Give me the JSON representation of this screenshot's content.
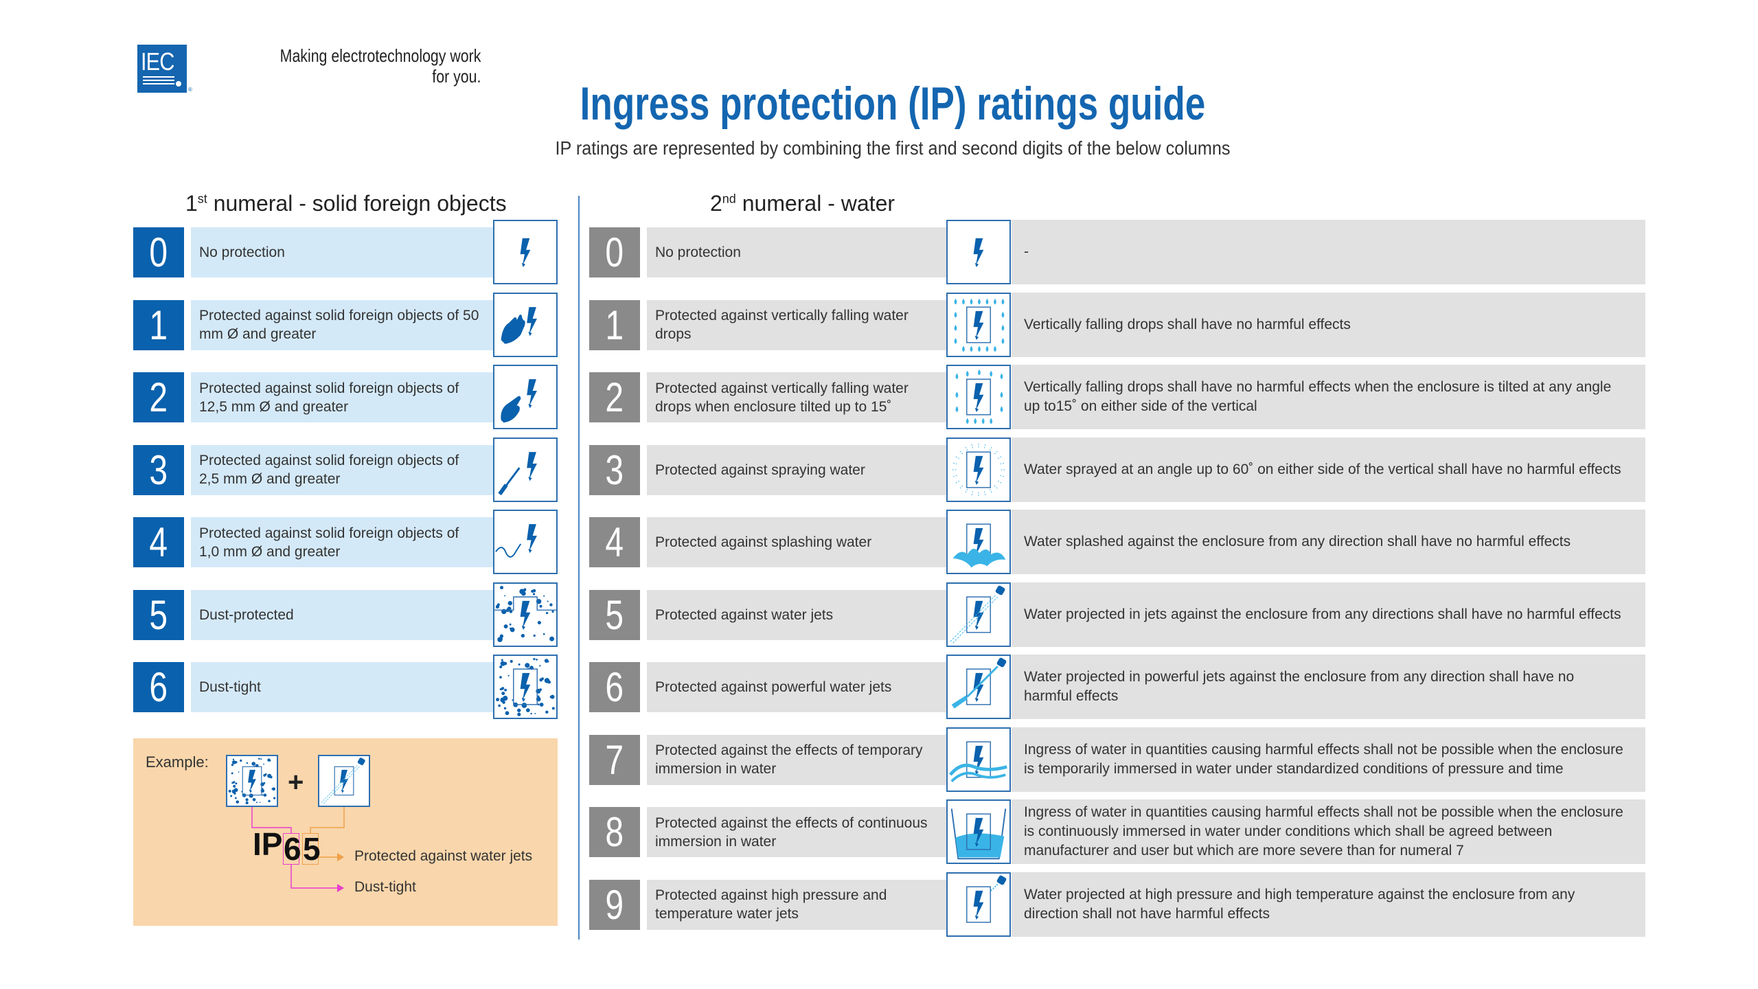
{
  "header": {
    "logo_text": "IEC",
    "logo_registered": "®",
    "tagline_line1": "Making  electrotechnology work",
    "tagline_line2": "for you.",
    "title": "Ingress protection (IP) ratings guide",
    "subtitle": "IP ratings are represented by combining the first and second digits of the below columns"
  },
  "colors": {
    "brand_blue": "#0a61ad",
    "title_blue": "#1466b0",
    "solid_band": "#d4e9f8",
    "water_number": "#8a8a8a",
    "water_band": "#e1e1e1",
    "example_bg": "#f9d6ab",
    "example_first_digit": "#e83fce",
    "example_second_digit": "#f0a04a"
  },
  "solids": {
    "heading_prefix": "1",
    "heading_sup": "st",
    "heading_rest": " numeral - solid foreign objects",
    "rows": [
      {
        "numeral": "0",
        "text": "No protection",
        "icon": "bolt-icon"
      },
      {
        "numeral": "1",
        "text": "Protected against solid foreign objects of 50 mm Ø and greater",
        "icon": "hand-icon"
      },
      {
        "numeral": "2",
        "text": "Protected against solid foreign objects of 12,5 mm Ø and greater",
        "icon": "finger-icon"
      },
      {
        "numeral": "3",
        "text": "Protected against solid foreign objects of 2,5 mm Ø and greater",
        "icon": "screwdriver-icon"
      },
      {
        "numeral": "4",
        "text": "Protected against solid foreign objects of 1,0 mm Ø and greater",
        "icon": "wire-icon"
      },
      {
        "numeral": "5",
        "text": "Dust-protected",
        "icon": "dust-protected-icon"
      },
      {
        "numeral": "6",
        "text": "Dust-tight",
        "icon": "dust-tight-icon"
      }
    ]
  },
  "water": {
    "heading_prefix": "2",
    "heading_sup": "nd",
    "heading_rest": " numeral - water",
    "rows": [
      {
        "numeral": "0",
        "text": "No protection",
        "icon": "bolt-icon",
        "description": "-"
      },
      {
        "numeral": "1",
        "text": "Protected against vertically falling water drops",
        "icon": "dripping-icon",
        "description": "Vertically falling drops shall have no harmful effects"
      },
      {
        "numeral": "2",
        "text": "Protected against vertically falling water drops when enclosure tilted up to 15˚",
        "icon": "dripping-tilted-icon",
        "description": "Vertically falling drops shall have no harmful effects when the enclosure is tilted at any angle up to15˚ on either side of the vertical"
      },
      {
        "numeral": "3",
        "text": "Protected against spraying water",
        "icon": "spray-icon",
        "description": "Water sprayed at an angle up to 60˚ on either side of the vertical shall have no harmful effects"
      },
      {
        "numeral": "4",
        "text": "Protected against splashing water",
        "icon": "splash-icon",
        "description": "Water splashed against the enclosure from any direction shall have no harmful effects"
      },
      {
        "numeral": "5",
        "text": "Protected against water jets",
        "icon": "water-jet-icon",
        "description": "Water projected in jets against the enclosure from any directions shall have no harmful effects"
      },
      {
        "numeral": "6",
        "text": "Protected against powerful water jets",
        "icon": "powerful-jet-icon",
        "description": "Water projected in powerful jets against the enclosure from any direction shall have no harmful effects"
      },
      {
        "numeral": "7",
        "text": "Protected against the effects of temporary immersion in water",
        "icon": "temporary-immersion-icon",
        "description": "Ingress of water in quantities causing harmful effects shall not be possible when the enclosure is temporarily immersed in water under standardized conditions of pressure and time"
      },
      {
        "numeral": "8",
        "text": "Protected against the effects of continuous immersion in water",
        "icon": "continuous-immersion-icon",
        "description": "Ingress of water in quantities causing harmful effects shall not be possible when the enclosure is continuously immersed in water under conditions which shall be agreed between manufacturer and user but which are more severe than for numeral 7"
      },
      {
        "numeral": "9",
        "text": "Protected against high pressure and temperature water jets",
        "icon": "high-pressure-jet-icon",
        "description": "Water projected at high pressure and high temperature against the enclosure from any direction shall not have harmful effects"
      }
    ]
  },
  "example": {
    "label": "Example:",
    "plus": "+",
    "prefix": "IP",
    "first_digit": "6",
    "second_digit": "5",
    "second_meaning": "Protected against water jets",
    "first_meaning": "Dust-tight"
  }
}
